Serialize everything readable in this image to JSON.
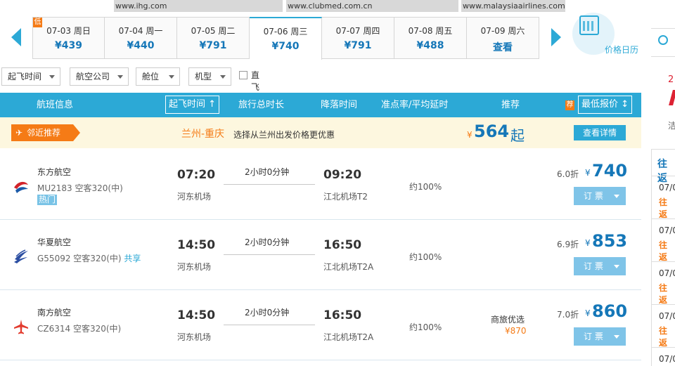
{
  "urls": [
    "www.ihg.com",
    "www.clubmed.com.cn",
    "www.malaysiaairlines.com"
  ],
  "low_badge": "低",
  "dates": [
    {
      "date": "07-03 周日",
      "price": "¥439"
    },
    {
      "date": "07-04 周一",
      "price": "¥440"
    },
    {
      "date": "07-05 周二",
      "price": "¥791"
    },
    {
      "date": "07-06 周三",
      "price": "¥740"
    },
    {
      "date": "07-07 周四",
      "price": "¥791"
    },
    {
      "date": "07-08 周五",
      "price": "¥488"
    },
    {
      "date": "07-09 周六",
      "price": "查看"
    }
  ],
  "calendar_label": "价格日历",
  "filters": {
    "dep_time": "起飞时间",
    "airline": "航空公司",
    "cabin": "舱位",
    "aircraft": "机型",
    "direct": "直飞"
  },
  "header": {
    "flight_info": "航班信息",
    "dep_time": "起飞时间",
    "duration": "旅行总时长",
    "arr_time": "降落时间",
    "ontime": "准点率/平均延时",
    "recommend": "推荐",
    "jian": "荐",
    "lowest": "最低报价",
    "sort_icon": "up-arrow"
  },
  "recommendation": {
    "tag": "邻近推荐",
    "route": "兰州-重庆",
    "desc": "选择从兰州出发价格更优惠",
    "currency": "¥",
    "price": "564",
    "suffix": "起",
    "detail_button": "查看详情"
  },
  "flights": [
    {
      "airline": "东方航空",
      "flight_no": "MU2183 空客320(中)",
      "share": "",
      "hot": "热门",
      "dep_time": "07:20",
      "dep_airport": "河东机场",
      "duration": "2小时0分钟",
      "arr_time": "09:20",
      "arr_airport": "江北机场T2",
      "ontime": "约100%",
      "promo": "",
      "promo_price": "",
      "discount": "6.0折",
      "currency": "¥",
      "price": "740",
      "book": "订 票",
      "logo_color": "#d2232a"
    },
    {
      "airline": "华夏航空",
      "flight_no": "G55092 空客320(中)",
      "share": "共享",
      "hot": "",
      "dep_time": "14:50",
      "dep_airport": "河东机场",
      "duration": "2小时0分钟",
      "arr_time": "16:50",
      "arr_airport": "江北机场T2A",
      "ontime": "约100%",
      "promo": "",
      "promo_price": "",
      "discount": "6.9折",
      "currency": "¥",
      "price": "853",
      "book": "订 票",
      "logo_color": "#2b4ea2"
    },
    {
      "airline": "南方航空",
      "flight_no": "CZ6314 空客320(中)",
      "share": "",
      "hot": "",
      "dep_time": "14:50",
      "dep_airport": "河东机场",
      "duration": "2小时0分钟",
      "arr_time": "16:50",
      "arr_airport": "江北机场T2A",
      "ontime": "约100%",
      "promo": "商旅优选",
      "promo_price": "¥870",
      "discount": "7.0折",
      "currency": "¥",
      "price": "860",
      "book": "订 票",
      "logo_color": "#e23b2e"
    }
  ],
  "side_panel": {
    "red_text": "2",
    "gray_text": "洁",
    "title": "往返",
    "dates": [
      "07/0",
      "07/0",
      "07/0",
      "07/0",
      "07/0"
    ],
    "labels": [
      "往返",
      "往返",
      "往返",
      "往返"
    ]
  }
}
